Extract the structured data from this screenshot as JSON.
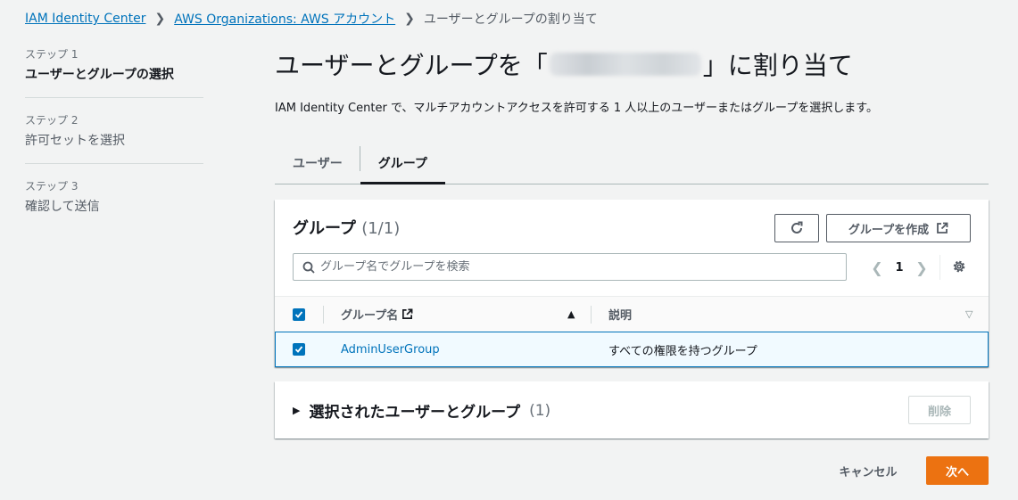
{
  "breadcrumb": {
    "items": [
      "IAM Identity Center",
      "AWS Organizations: AWS アカウント"
    ],
    "current": "ユーザーとグループの割り当て"
  },
  "steps": [
    {
      "num": "ステップ 1",
      "label": "ユーザーとグループの選択"
    },
    {
      "num": "ステップ 2",
      "label": "許可セットを選択"
    },
    {
      "num": "ステップ 3",
      "label": "確認して送信"
    }
  ],
  "page": {
    "title_prefix": "ユーザーとグループを「",
    "title_suffix": "」に割り当て",
    "description": "IAM Identity Center で、マルチアカウントアクセスを許可する 1 人以上のユーザーまたはグループを選択します。"
  },
  "tabs": [
    {
      "label": "ユーザー"
    },
    {
      "label": "グループ"
    }
  ],
  "groups_panel": {
    "title": "グループ",
    "count": "(1/1)",
    "create_label": "グループを作成",
    "search_placeholder": "グループ名でグループを検索",
    "page_number": "1",
    "columns": {
      "name": "グループ名",
      "description": "説明"
    },
    "rows": [
      {
        "name": "AdminUserGroup",
        "description": "すべての権限を持つグループ"
      }
    ]
  },
  "selected_section": {
    "title": "選択されたユーザーとグループ",
    "count": "(1)",
    "delete_label": "削除"
  },
  "footer": {
    "cancel_label": "キャンセル",
    "next_label": "次へ"
  },
  "colors": {
    "link": "#0073bb",
    "primary": "#ec7211",
    "background": "#f2f3f3"
  }
}
